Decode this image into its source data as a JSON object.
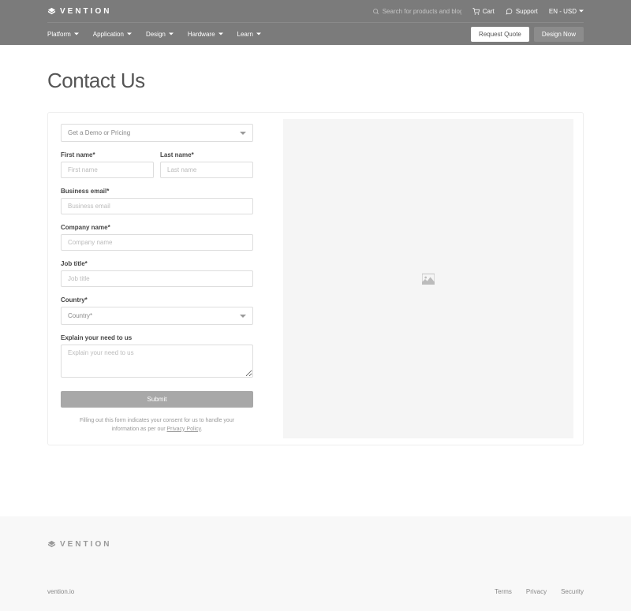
{
  "header": {
    "brand": "VENTION",
    "search_placeholder": "Search for products and blogs",
    "cart": "Cart",
    "support": "Support",
    "lang": "EN - USD",
    "nav": [
      "Platform",
      "Application",
      "Design",
      "Hardware",
      "Learn"
    ],
    "quote_btn": "Request Quote",
    "design_btn": "Design Now"
  },
  "page": {
    "title": "Contact Us"
  },
  "form": {
    "topic_selected": "Get a Demo or Pricing",
    "first_name_label": "First name*",
    "first_name_placeholder": "First name",
    "last_name_label": "Last name*",
    "last_name_placeholder": "Last name",
    "email_label": "Business email*",
    "email_placeholder": "Business email",
    "company_label": "Company name*",
    "company_placeholder": "Company name",
    "job_label": "Job title*",
    "job_placeholder": "Job title",
    "country_label": "Country*",
    "country_placeholder": "Country*",
    "need_label": "Explain your need to us",
    "need_placeholder": "Explain your need to us",
    "submit": "Submit",
    "consent_pre": "Filling out this form indicates your consent for us to handle your information as per our ",
    "consent_link": "Privacy Policy",
    "consent_post": "."
  },
  "footer": {
    "brand": "VENTION",
    "domain": "vention.io",
    "links": [
      "Terms",
      "Privacy",
      "Security"
    ]
  }
}
